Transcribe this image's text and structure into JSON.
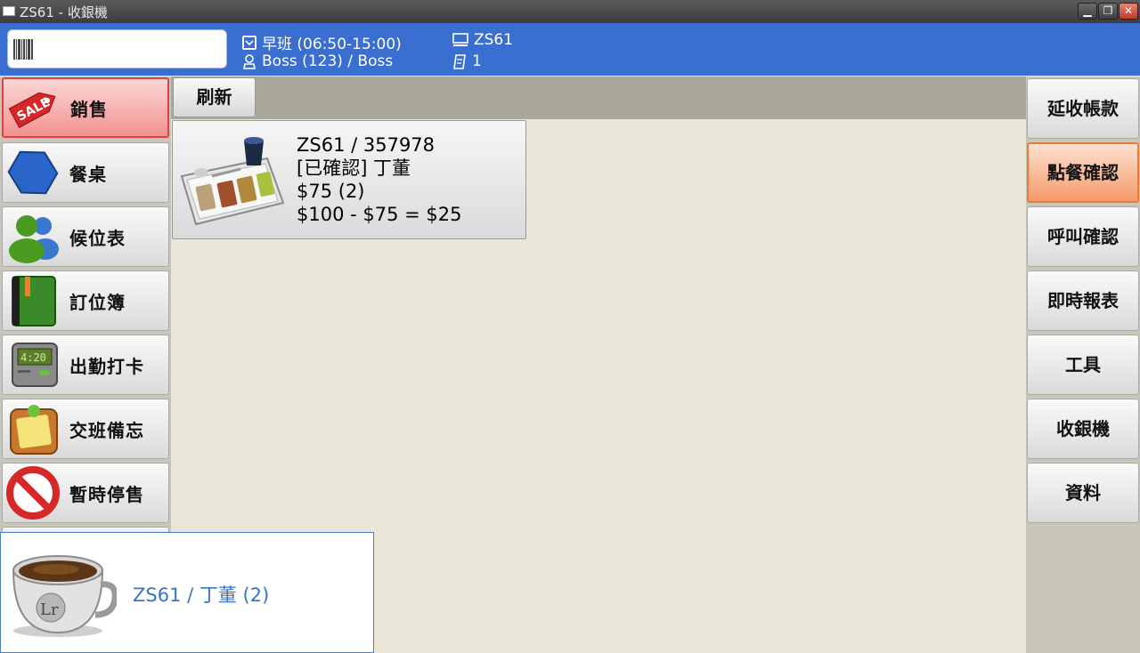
{
  "window": {
    "title": "ZS61 - 收銀機",
    "min": "▁",
    "max": "❐",
    "close": "✕"
  },
  "header": {
    "barcode_placeholder": "",
    "shift": "早班 (06:50-15:00)",
    "user": "Boss (123) / Boss",
    "terminal": "ZS61",
    "count": "1"
  },
  "left_menu": [
    {
      "label": "銷售",
      "icon": "sale-tag-icon",
      "active": true
    },
    {
      "label": "餐桌",
      "icon": "hexagon-icon"
    },
    {
      "label": "候位表",
      "icon": "users-icon"
    },
    {
      "label": "訂位簿",
      "icon": "book-icon"
    },
    {
      "label": "出勤打卡",
      "icon": "clock-icon"
    },
    {
      "label": "交班備忘",
      "icon": "memo-icon"
    },
    {
      "label": "暫時停售",
      "icon": "no-entry-icon"
    }
  ],
  "center": {
    "refresh_label": "刷新",
    "order": {
      "line1": "ZS61 / 357978",
      "line2": "[已確認] 丁董",
      "line3": "$75 (2)",
      "line4": "$100 - $75 = $25"
    }
  },
  "right_menu": [
    {
      "label": "延收帳款"
    },
    {
      "label": "點餐確認",
      "highlight": true
    },
    {
      "label": "呼叫確認"
    },
    {
      "label": "即時報表"
    },
    {
      "label": "工具"
    },
    {
      "label": "收銀機"
    },
    {
      "label": "資料"
    }
  ],
  "notification": {
    "text": "ZS61 / 丁董 (2)"
  },
  "colors": {
    "header": "#3a6ed0",
    "active_red": "#e04040",
    "highlight_orange": "#ea7a3c",
    "notify_text": "#3b74c7"
  }
}
